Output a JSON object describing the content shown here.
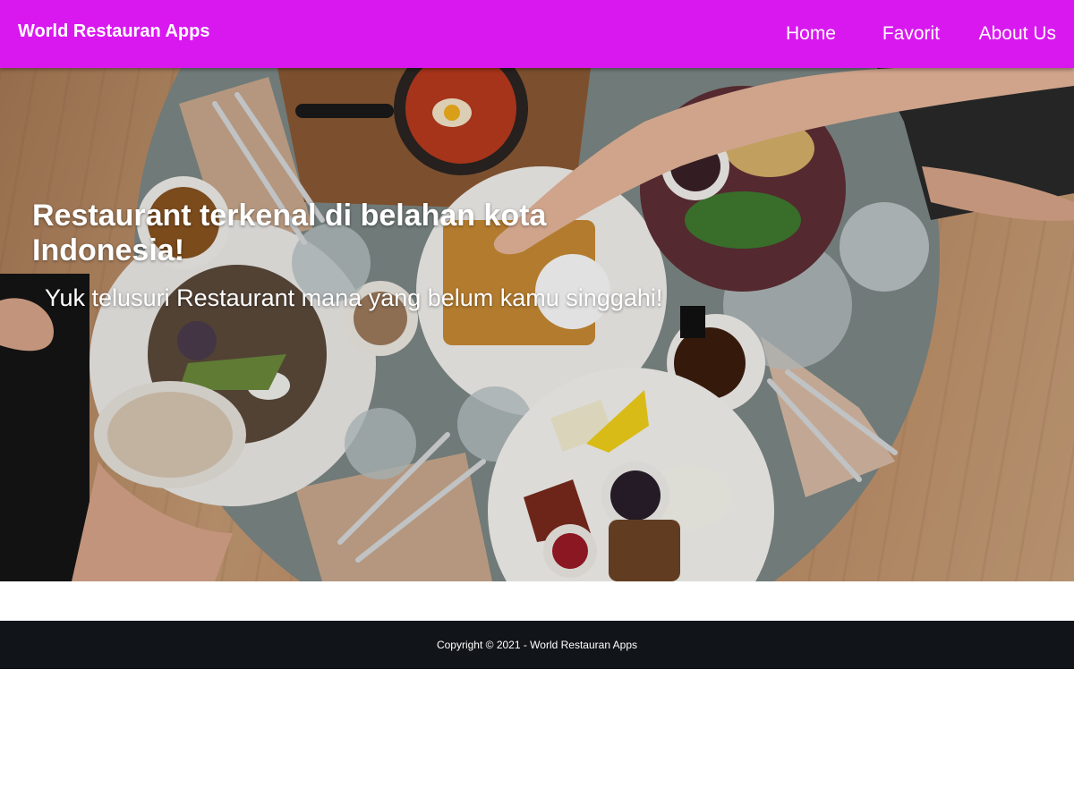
{
  "header": {
    "brand": "World Restauran Apps",
    "nav": [
      "Home",
      "Favorit",
      "About Us"
    ],
    "background_color": "#d918f0"
  },
  "hero": {
    "title": "Restaurant terkenal di belahan kota Indonesia!",
    "subtitle": "Yuk telusuri Restaurant mana yang belum kamu singgahi!"
  },
  "footer": {
    "copyright": "Copyright © 2021 - World Restauran Apps",
    "background_color": "#111418"
  }
}
